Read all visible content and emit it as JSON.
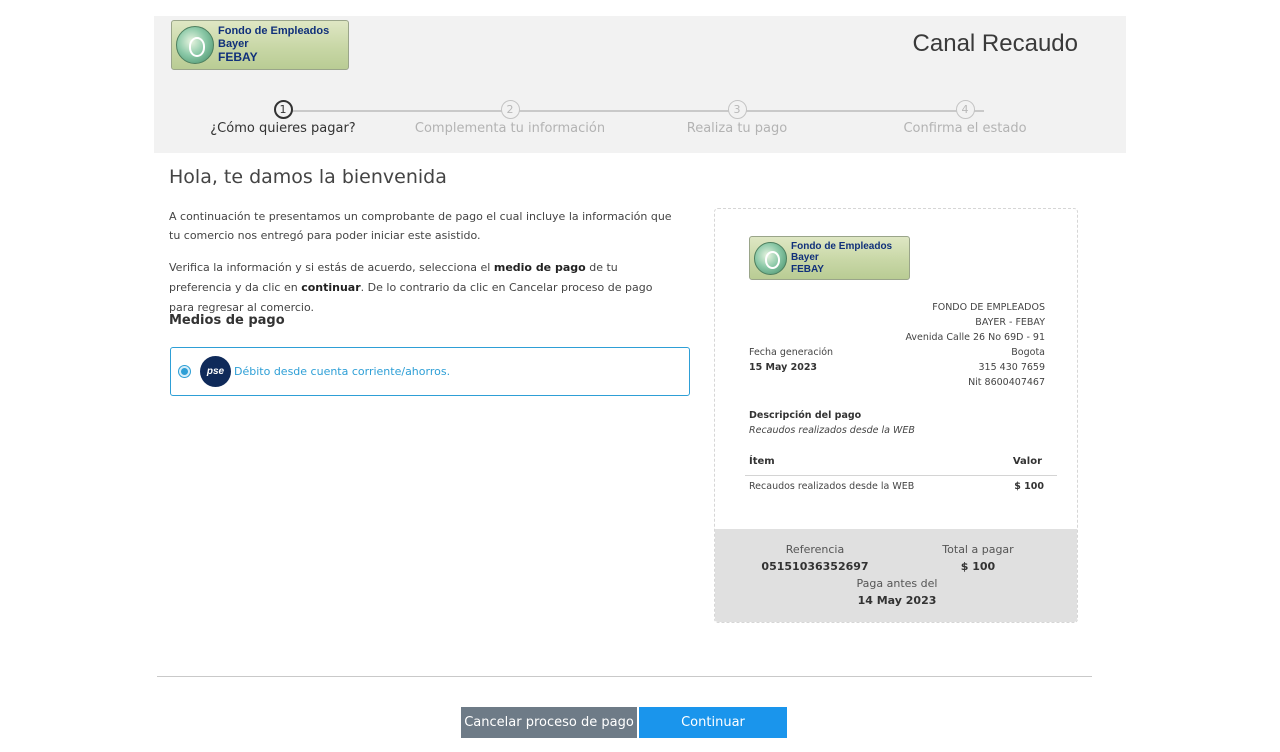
{
  "header": {
    "logo": {
      "line1": "Fondo de Empleados Bayer",
      "line2": "FEBAY"
    },
    "title": "Canal Recaudo"
  },
  "steps": [
    {
      "number": "1",
      "label": "¿Cómo quieres pagar?",
      "active": true
    },
    {
      "number": "2",
      "label": "Complementa tu información",
      "active": false
    },
    {
      "number": "3",
      "label": "Realiza tu pago",
      "active": false
    },
    {
      "number": "4",
      "label": "Confirma el estado",
      "active": false
    }
  ],
  "main": {
    "welcome": "Hola, te damos la bienvenida",
    "intro": "A continuación te presentamos un comprobante de pago el cual incluye la información que tu comercio nos entregó para poder iniciar este asistido.",
    "verify_pre": "Verifica la información y si estás de acuerdo, selecciona el ",
    "verify_bold1": "medio de pago",
    "verify_mid": " de tu preferencia y da clic en ",
    "verify_bold2": "continuar",
    "verify_post": ". De lo contrario da clic en Cancelar proceso de pago para regresar al comercio.",
    "medios_title": "Medios de pago",
    "payment_option": {
      "logo_text": "pse",
      "label": "Débito desde cuenta corriente/ahorros.",
      "selected": true
    }
  },
  "receipt": {
    "logo": {
      "line1": "Fondo de Empleados Bayer",
      "line2": "FEBAY"
    },
    "company_lines": [
      "FONDO DE EMPLEADOS",
      "BAYER - FEBAY",
      "Avenida Calle 26 No 69D - 91",
      "Bogota",
      "315 430 7659",
      "Nit 8600407467"
    ],
    "fecha_label": "Fecha generación",
    "fecha_value": "15 May 2023",
    "description_title": "Descripción del pago",
    "description_value": "Recaudos realizados desde la WEB",
    "table": {
      "col_item": "Ítem",
      "col_value": "Valor",
      "rows": [
        {
          "item": "Recaudos realizados desde la WEB",
          "value": "$ 100"
        }
      ]
    },
    "footer": {
      "referencia_label": "Referencia",
      "referencia_value": "05151036352697",
      "total_label": "Total a pagar",
      "total_value": "$ 100",
      "paga_label": "Paga antes del",
      "paga_value": "14 May 2023"
    }
  },
  "actions": {
    "cancel_label": "Cancelar proceso de pago",
    "continue_label": "Continuar"
  },
  "colors": {
    "primary": "#1a95ec",
    "accent_border": "#2e9fd6",
    "cancel": "#6e7b87",
    "header_bg": "#f2f2f2",
    "receipt_footer_bg": "#e0e0e0"
  }
}
